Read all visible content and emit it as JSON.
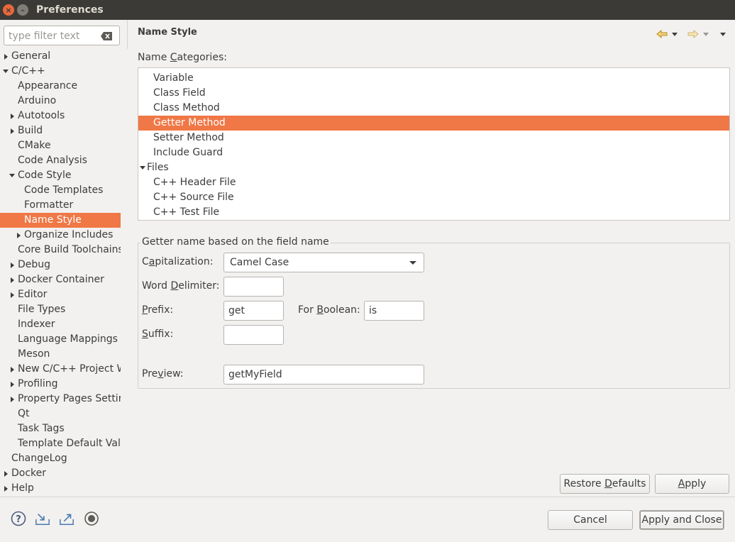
{
  "window": {
    "title": "Preferences"
  },
  "filter": {
    "placeholder": "type filter text"
  },
  "tree": [
    {
      "label": "General",
      "level": 0,
      "arrow": "right"
    },
    {
      "label": "C/C++",
      "level": 0,
      "arrow": "down"
    },
    {
      "label": "Appearance",
      "level": 1,
      "arrow": ""
    },
    {
      "label": "Arduino",
      "level": 1,
      "arrow": ""
    },
    {
      "label": "Autotools",
      "level": 1,
      "arrow": "right"
    },
    {
      "label": "Build",
      "level": 1,
      "arrow": "right"
    },
    {
      "label": "CMake",
      "level": 1,
      "arrow": ""
    },
    {
      "label": "Code Analysis",
      "level": 1,
      "arrow": ""
    },
    {
      "label": "Code Style",
      "level": 1,
      "arrow": "down"
    },
    {
      "label": "Code Templates",
      "level": 2,
      "arrow": ""
    },
    {
      "label": "Formatter",
      "level": 2,
      "arrow": ""
    },
    {
      "label": "Name Style",
      "level": 2,
      "arrow": "",
      "selected": true
    },
    {
      "label": "Organize Includes",
      "level": 2,
      "arrow": "right"
    },
    {
      "label": "Core Build Toolchains",
      "level": 1,
      "arrow": ""
    },
    {
      "label": "Debug",
      "level": 1,
      "arrow": "right"
    },
    {
      "label": "Docker Container",
      "level": 1,
      "arrow": "right"
    },
    {
      "label": "Editor",
      "level": 1,
      "arrow": "right"
    },
    {
      "label": "File Types",
      "level": 1,
      "arrow": ""
    },
    {
      "label": "Indexer",
      "level": 1,
      "arrow": ""
    },
    {
      "label": "Language Mappings",
      "level": 1,
      "arrow": ""
    },
    {
      "label": "Meson",
      "level": 1,
      "arrow": ""
    },
    {
      "label": "New C/C++ Project Wi",
      "level": 1,
      "arrow": "right"
    },
    {
      "label": "Profiling",
      "level": 1,
      "arrow": "right"
    },
    {
      "label": "Property Pages Settir",
      "level": 1,
      "arrow": "right"
    },
    {
      "label": "Qt",
      "level": 1,
      "arrow": ""
    },
    {
      "label": "Task Tags",
      "level": 1,
      "arrow": ""
    },
    {
      "label": "Template Default Valu",
      "level": 1,
      "arrow": ""
    },
    {
      "label": "ChangeLog",
      "level": 0,
      "arrow": ""
    },
    {
      "label": "Docker",
      "level": 0,
      "arrow": "right"
    },
    {
      "label": "Help",
      "level": 0,
      "arrow": "right"
    }
  ],
  "page": {
    "title": "Name Style",
    "categories_label_pre": "Name ",
    "categories_label_u": "C",
    "categories_label_post": "ategories:",
    "categories": [
      {
        "label": "Variable",
        "indent": 1
      },
      {
        "label": "Class Field",
        "indent": 1
      },
      {
        "label": "Class Method",
        "indent": 1
      },
      {
        "label": "Getter Method",
        "indent": 1,
        "selected": true
      },
      {
        "label": "Setter Method",
        "indent": 1
      },
      {
        "label": "Include Guard",
        "indent": 1
      },
      {
        "label": "Files",
        "indent": 0,
        "arrow": "down"
      },
      {
        "label": "C++ Header File",
        "indent": 1
      },
      {
        "label": "C++ Source File",
        "indent": 1
      },
      {
        "label": "C++ Test File",
        "indent": 1
      }
    ],
    "group_title": "Getter name based on the field name",
    "capitalization": {
      "label_pre": "C",
      "label_u": "a",
      "label_post": "pitalization:",
      "value": "Camel Case"
    },
    "word_delimiter": {
      "label_pre": "Word ",
      "label_u": "D",
      "label_post": "elimiter:",
      "value": ""
    },
    "prefix": {
      "label_pre": "",
      "label_u": "P",
      "label_post": "refix:",
      "value": "get"
    },
    "for_boolean": {
      "label_pre": "For ",
      "label_u": "B",
      "label_post": "oolean:",
      "value": "is"
    },
    "suffix": {
      "label_pre": "",
      "label_u": "S",
      "label_post": "uffix:",
      "value": ""
    },
    "preview": {
      "label_pre": "Pre",
      "label_u": "v",
      "label_post": "iew:",
      "value": "getMyField"
    },
    "restore_defaults": {
      "pre": "Restore ",
      "u": "D",
      "post": "efaults"
    },
    "apply": {
      "pre": "",
      "u": "A",
      "post": "pply"
    }
  },
  "footer": {
    "cancel": "Cancel",
    "apply_close": "Apply and Close",
    "icons": [
      "help-icon",
      "import-icon",
      "export-icon",
      "record-icon"
    ]
  },
  "colors": {
    "selection": "#f07746",
    "titlebar": "#3b3a36"
  }
}
